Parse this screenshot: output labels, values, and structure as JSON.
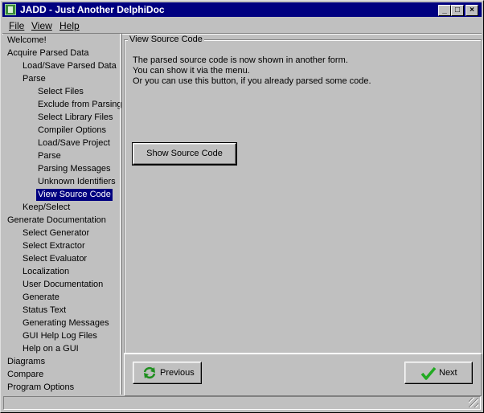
{
  "window": {
    "title": "JADD - Just Another DelphiDoc"
  },
  "captions": {
    "minimize": "_",
    "maximize": "□",
    "close": "×"
  },
  "menu": [
    {
      "label": "File"
    },
    {
      "label": "View"
    },
    {
      "label": "Help"
    }
  ],
  "tree": [
    {
      "label": "Welcome!",
      "level": 0
    },
    {
      "label": "Acquire Parsed Data",
      "level": 0
    },
    {
      "label": "Load/Save Parsed Data",
      "level": 1
    },
    {
      "label": "Parse",
      "level": 1
    },
    {
      "label": "Select Files",
      "level": 2
    },
    {
      "label": "Exclude from Parsing",
      "level": 2
    },
    {
      "label": "Select Library Files",
      "level": 2
    },
    {
      "label": "Compiler Options",
      "level": 2
    },
    {
      "label": "Load/Save Project",
      "level": 2
    },
    {
      "label": "Parse",
      "level": 2
    },
    {
      "label": "Parsing Messages",
      "level": 2
    },
    {
      "label": "Unknown Identifiers",
      "level": 2
    },
    {
      "label": "View Source Code",
      "level": 2,
      "selected": true
    },
    {
      "label": "Keep/Select",
      "level": 1
    },
    {
      "label": "Generate Documentation",
      "level": 0
    },
    {
      "label": "Select Generator",
      "level": 1
    },
    {
      "label": "Select Extractor",
      "level": 1
    },
    {
      "label": "Select Evaluator",
      "level": 1
    },
    {
      "label": "Localization",
      "level": 1
    },
    {
      "label": "User Documentation",
      "level": 1
    },
    {
      "label": "Generate",
      "level": 1
    },
    {
      "label": "Status Text",
      "level": 1
    },
    {
      "label": "Generating Messages",
      "level": 1
    },
    {
      "label": "GUI Help Log Files",
      "level": 1
    },
    {
      "label": "Help on a GUI",
      "level": 1
    },
    {
      "label": "Diagrams",
      "level": 0
    },
    {
      "label": "Compare",
      "level": 0
    },
    {
      "label": "Program Options",
      "level": 0
    }
  ],
  "page": {
    "group_title": "View Source Code",
    "lines": [
      "The parsed source code is now shown in another form.",
      "You can show it via the menu.",
      "Or you can use this button, if you already parsed some code."
    ],
    "show_source_button": "Show Source Code"
  },
  "nav": {
    "previous": "Previous",
    "next": "Next",
    "previous_icon": "refresh-arrows-icon",
    "next_icon": "checkmark-icon"
  },
  "colors": {
    "titlebar": "#000080",
    "selection": "#000080",
    "face": "#c0c0c0",
    "check_green": "#22aa22"
  }
}
